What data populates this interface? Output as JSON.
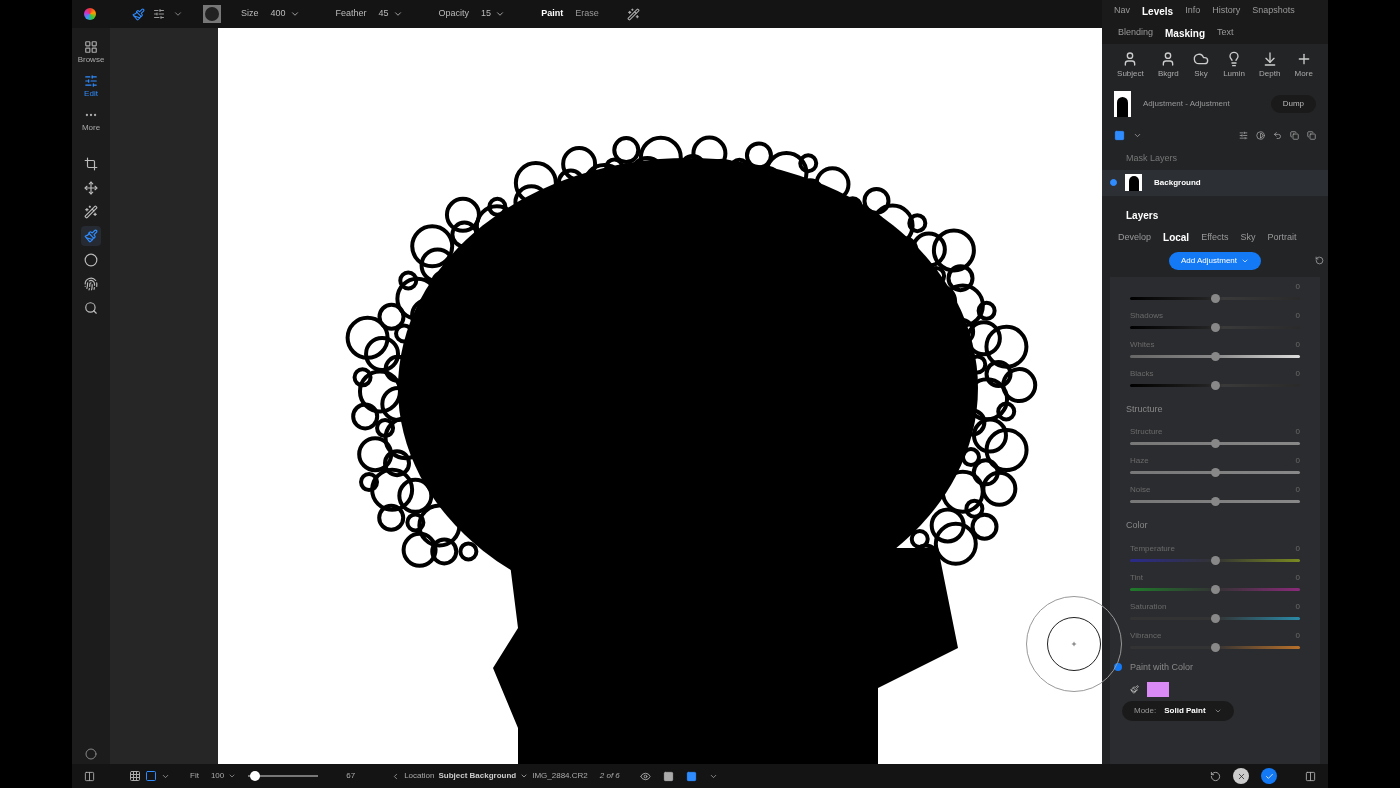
{
  "top_bar": {
    "brush_menu": {
      "selected": true
    },
    "size": {
      "label": "Size",
      "value": "400"
    },
    "feather": {
      "label": "Feather",
      "value": "45"
    },
    "opacity": {
      "label": "Opacity",
      "value": "15"
    },
    "modes": [
      {
        "label": "Paint",
        "selected": true
      },
      {
        "label": "Erase",
        "selected": false
      }
    ]
  },
  "left_toolbar": {
    "nav": [
      {
        "label": "Browse",
        "selected": false
      },
      {
        "label": "Edit",
        "selected": true
      },
      {
        "label": "More",
        "selected": false
      }
    ],
    "tools": [
      {
        "selected": false
      },
      {
        "selected": false
      },
      {
        "selected": false
      },
      {
        "selected": true
      },
      {
        "selected": false
      },
      {
        "selected": false
      },
      {
        "selected": false
      }
    ]
  },
  "panel_tabs": [
    {
      "label": "Nav",
      "selected": false
    },
    {
      "label": "Levels",
      "selected": true
    },
    {
      "label": "Info",
      "selected": false
    },
    {
      "label": "History",
      "selected": false
    },
    {
      "label": "Snapshots",
      "selected": false
    }
  ],
  "module_tabs": [
    {
      "label": "Blending",
      "selected": false
    },
    {
      "label": "Masking",
      "selected": true
    },
    {
      "label": "Text",
      "selected": false
    }
  ],
  "mask_tools": [
    {
      "label": "Subject"
    },
    {
      "label": "Bkgrd"
    },
    {
      "label": "Sky"
    },
    {
      "label": "Lumin"
    },
    {
      "label": "Depth"
    },
    {
      "label": "More"
    }
  ],
  "adjustment": {
    "name": "Adjustment - Adjustment",
    "button": "Dump"
  },
  "mask_layers": {
    "title": "Mask Layers",
    "items": [
      {
        "name": "Background",
        "selected": true
      }
    ]
  },
  "layers": {
    "title": "Layers",
    "tabs": [
      {
        "label": "Develop",
        "selected": false
      },
      {
        "label": "Local",
        "selected": true
      },
      {
        "label": "Effects",
        "selected": false
      },
      {
        "label": "Sky",
        "selected": false
      },
      {
        "label": "Portrait",
        "selected": false
      }
    ],
    "add_button": "Add Adjustment"
  },
  "sections": [
    {
      "sliders": [
        {
          "kind": "dark",
          "value": "0",
          "level": 0.5
        },
        {
          "label": "Shadows",
          "kind": "dark",
          "value": "0",
          "level": 0.5
        },
        {
          "label": "Whites",
          "kind": "light",
          "value": "0",
          "level": 0.5
        },
        {
          "label": "Blacks",
          "kind": "dark",
          "value": "0",
          "level": 0.5
        }
      ]
    },
    {
      "title": "Structure",
      "sliders": [
        {
          "label": "Structure",
          "kind": "neutral",
          "value": "0",
          "level": 0.5
        },
        {
          "label": "Haze",
          "kind": "neutral",
          "value": "0",
          "level": 0.5
        },
        {
          "label": "Noise",
          "kind": "neutral",
          "value": "0",
          "level": 0.5
        }
      ]
    },
    {
      "title": "Color",
      "sliders": [
        {
          "label": "Temperature",
          "kind": "temperature",
          "value": "0",
          "level": 0.5
        },
        {
          "label": "Tint",
          "kind": "tint",
          "value": "0",
          "level": 0.5
        },
        {
          "label": "Saturation",
          "kind": "saturation",
          "value": "0",
          "level": 0.5
        },
        {
          "label": "Vibrance",
          "kind": "vibrance",
          "value": "0",
          "level": 0.5
        }
      ]
    }
  ],
  "paint_with_color": {
    "label": "Paint with Color",
    "on": true,
    "color": "#d98af5",
    "mode_label": "Mode:",
    "mode": "Solid Paint"
  },
  "bottom_bar": {
    "zoom_label": "Fit",
    "zoom_value": "100",
    "zoom_slider": {
      "level": 0.05
    },
    "zoom_reading": "67",
    "location_label": "Location",
    "location": "Subject Background",
    "file": "IMG_2884.CR2",
    "position": "2 of 6"
  }
}
